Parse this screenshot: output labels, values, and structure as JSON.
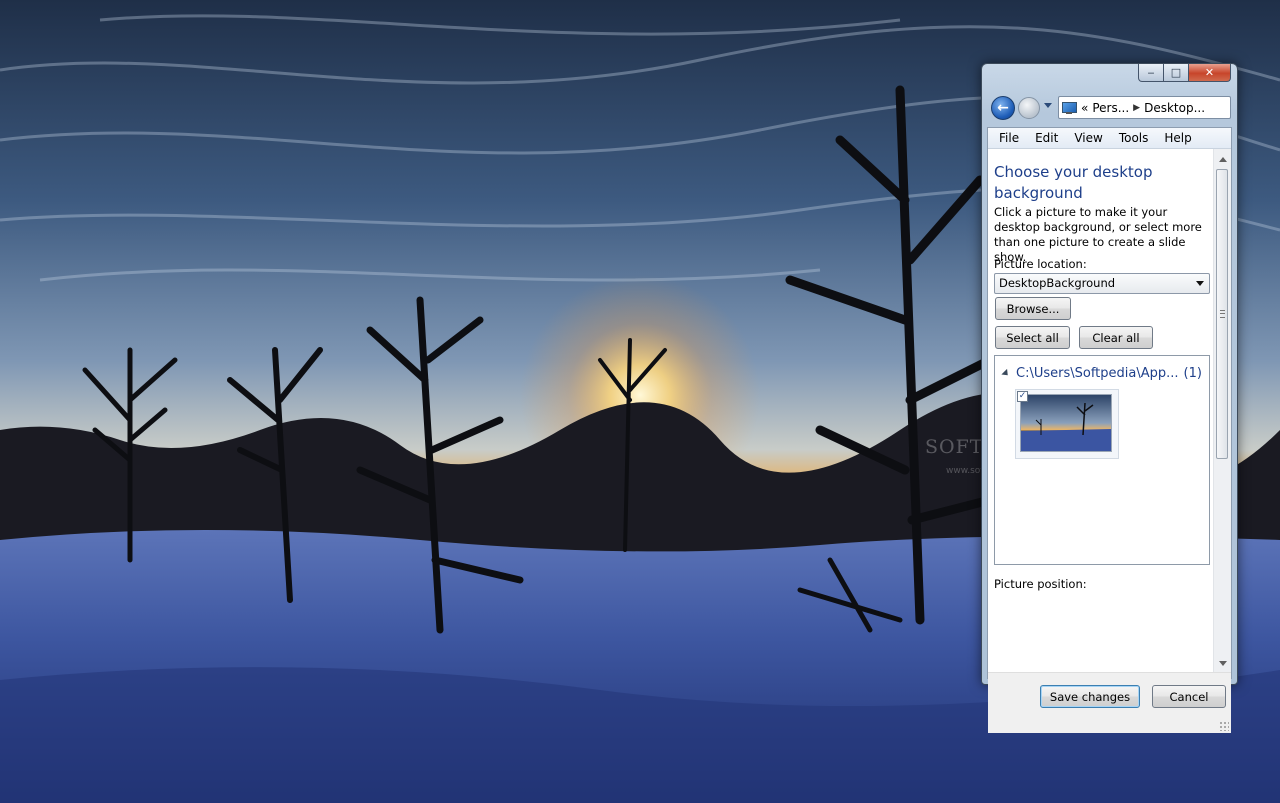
{
  "window": {
    "caption": {
      "minimize": "‒",
      "maximize": "□",
      "close": "✕"
    },
    "breadcrumb": {
      "prefix": "«",
      "segments": [
        "Pers...",
        "Desktop..."
      ]
    },
    "menu": [
      "File",
      "Edit",
      "View",
      "Tools",
      "Help"
    ],
    "heading": "Choose your desktop background",
    "description": "Click a picture to make it your desktop background, or select more than one picture to create a slide show.",
    "picture_location_label": "Picture location:",
    "picture_location_value": "DesktopBackground",
    "browse_label": "Browse...",
    "select_all_label": "Select all",
    "clear_all_label": "Clear all",
    "group": {
      "path": "C:\\Users\\Softpedia\\App...",
      "count": "(1)"
    },
    "thumbnail_checked": "✓",
    "picture_position_label": "Picture position:",
    "save_label": "Save changes",
    "cancel_label": "Cancel"
  },
  "watermark": {
    "logo": "SOFTPEDIA",
    "url": "www.softpedia.com"
  },
  "colors": {
    "heading": "#1e3f8a",
    "link_blue": "#1e3f8a",
    "close_red": "#c7452a"
  }
}
